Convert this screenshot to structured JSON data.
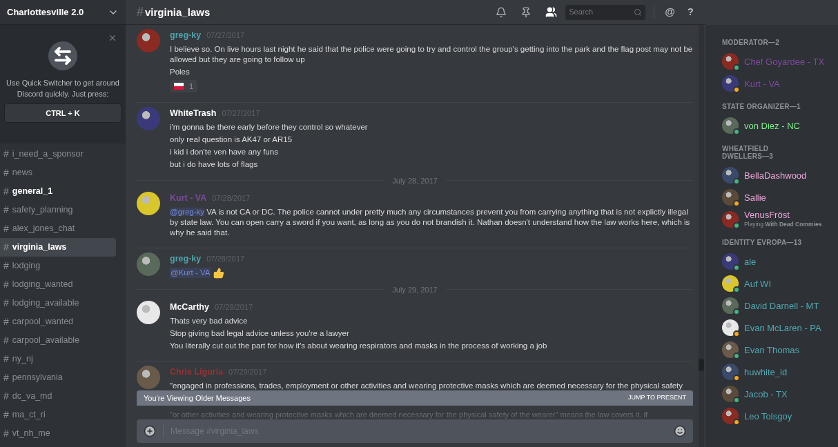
{
  "server": {
    "name": "Charlottesville 2.0"
  },
  "quick_switcher": {
    "text": "Use Quick Switcher to get around Discord quickly. Just press:",
    "shortcut": "CTRL + K"
  },
  "channel_prefix": "#",
  "channels": [
    {
      "name": "i_need_a_sponsor",
      "selected": false,
      "unread": false
    },
    {
      "name": "news",
      "selected": false,
      "unread": false
    },
    {
      "name": "general_1",
      "selected": false,
      "unread": true
    },
    {
      "name": "safety_planning",
      "selected": false,
      "unread": false
    },
    {
      "name": "alex_jones_chat",
      "selected": false,
      "unread": false
    },
    {
      "name": "virginia_laws",
      "selected": true,
      "unread": true
    },
    {
      "name": "lodging",
      "selected": false,
      "unread": false
    },
    {
      "name": "lodging_wanted",
      "selected": false,
      "unread": false
    },
    {
      "name": "lodging_available",
      "selected": false,
      "unread": false
    },
    {
      "name": "carpool_wanted",
      "selected": false,
      "unread": false
    },
    {
      "name": "carpool_available",
      "selected": false,
      "unread": false
    },
    {
      "name": "ny_nj",
      "selected": false,
      "unread": false
    },
    {
      "name": "pennsylvania",
      "selected": false,
      "unread": false
    },
    {
      "name": "dc_va_md",
      "selected": false,
      "unread": false
    },
    {
      "name": "ma_ct_ri",
      "selected": false,
      "unread": false
    },
    {
      "name": "vt_nh_me",
      "selected": false,
      "unread": false
    }
  ],
  "header": {
    "hash": "#",
    "channel": "virginia_laws",
    "search_placeholder": "Search",
    "icon_chars": [
      "@",
      "?"
    ]
  },
  "messages": [
    {
      "kind": "message",
      "author": "greg-ky",
      "color": "#4fa3a8",
      "timestamp": "07/27/2017",
      "lines": [
        {
          "text": "I believe so.  On live hours last night he said that the police were going to try and control the group's getting into the park and the flag post may not be allowed but they are going to follow up"
        },
        {
          "text": "Poles"
        }
      ],
      "reaction": {
        "count": "1"
      }
    },
    {
      "kind": "message",
      "author": "WhiteTrash",
      "color": "#ffffff",
      "timestamp": "07/27/2017",
      "lines": [
        {
          "text": "i'm gonna be there early before they control so whatever"
        },
        {
          "text": "only real question is AK47 or AR15"
        },
        {
          "text": "i  kid i don'te ven have any funs"
        },
        {
          "text": "but i do have lots of flags"
        }
      ]
    },
    {
      "kind": "divider",
      "label": "July 28, 2017"
    },
    {
      "kind": "message",
      "author": "Kurt - VA",
      "color": "#7e4a9c",
      "timestamp": "07/28/2017",
      "lines": [
        {
          "mention": "@greg-ky",
          "text": "VA is not CA or DC. The police cannot under pretty much any circumstances prevent you from carrying anything that is not explictly illegal by state law. You can open carry a sword if you want, as long as you do not brandish it. Nathan doesn't understand how the law works here, which is why he said that."
        }
      ]
    },
    {
      "kind": "message",
      "author": "greg-ky",
      "color": "#4fa3a8",
      "timestamp": "07/28/2017",
      "lines": [
        {
          "mention": "@Kurt - VA",
          "thumbs": true
        }
      ]
    },
    {
      "kind": "divider",
      "label": "July 29, 2017"
    },
    {
      "kind": "message",
      "author": "McCarthy",
      "color": "#ffffff",
      "timestamp": "07/29/2017",
      "lines": [
        {
          "text": "Thats very bad advice"
        },
        {
          "text": "Stop giving bad legal advice unless you're a lawyer"
        },
        {
          "text": "You literally cut out the part for how it's about wearing respirators and masks in the process of working a job"
        }
      ]
    },
    {
      "kind": "message",
      "author": "Chris Liguria",
      "color": "#9a3232",
      "timestamp": "07/29/2017",
      "lines": [
        {
          "text": "\"engaged in professions, trades, employment or other activities and wearing protective masks which are deemed necessary for the physical safety"
        }
      ]
    }
  ],
  "older_bar": {
    "text": "You're Viewing Older Messages",
    "action": "JUMP TO PRESENT"
  },
  "after_bar_line": "\"or other activities and wearing protective masks which are deemed necessary for the physical safety of the wearer\" means the law covers it. if",
  "composer": {
    "placeholder": "Message #virginia_laws"
  },
  "member_groups": [
    {
      "title": "MODERATOR—2",
      "color": "#7e4a9c",
      "members": [
        {
          "name": "Chef Goyardee - TX",
          "color": "#43b581"
        },
        {
          "name": "Kurt - VA",
          "color": "#faa61a"
        }
      ]
    },
    {
      "title": "STATE ORGANIZER—1",
      "color": "#7ef08a",
      "members": [
        {
          "name": "von Diez - NC",
          "color": "#43b581"
        }
      ]
    },
    {
      "title": "WHEATFIELD DWELLERS—3",
      "color": "#f0a6dc",
      "members": [
        {
          "name": "BellaDashwood",
          "color": "#43b581"
        },
        {
          "name": "Sallie",
          "color": "#faa61a"
        },
        {
          "name": "VenusFröst",
          "color": "#43b581",
          "activity": "Playing **With Dead Commies**"
        }
      ]
    },
    {
      "title": "IDENTITY EVROPA—13",
      "color": "#4fa9b0",
      "members": [
        {
          "name": "ale",
          "color": "#43b581"
        },
        {
          "name": "Auf WI",
          "color": "#43b581"
        },
        {
          "name": "David Darnell - MT",
          "color": "#43b581"
        },
        {
          "name": "Evan McLaren - PA",
          "color": "#faa61a"
        },
        {
          "name": "Evan Thomas",
          "color": "#43b581"
        },
        {
          "name": "huwhite_id",
          "color": "#faa61a"
        },
        {
          "name": "Jacob - TX",
          "color": "#43b581"
        },
        {
          "name": "Leo Tolsgoy",
          "color": "#faa61a"
        }
      ]
    }
  ]
}
